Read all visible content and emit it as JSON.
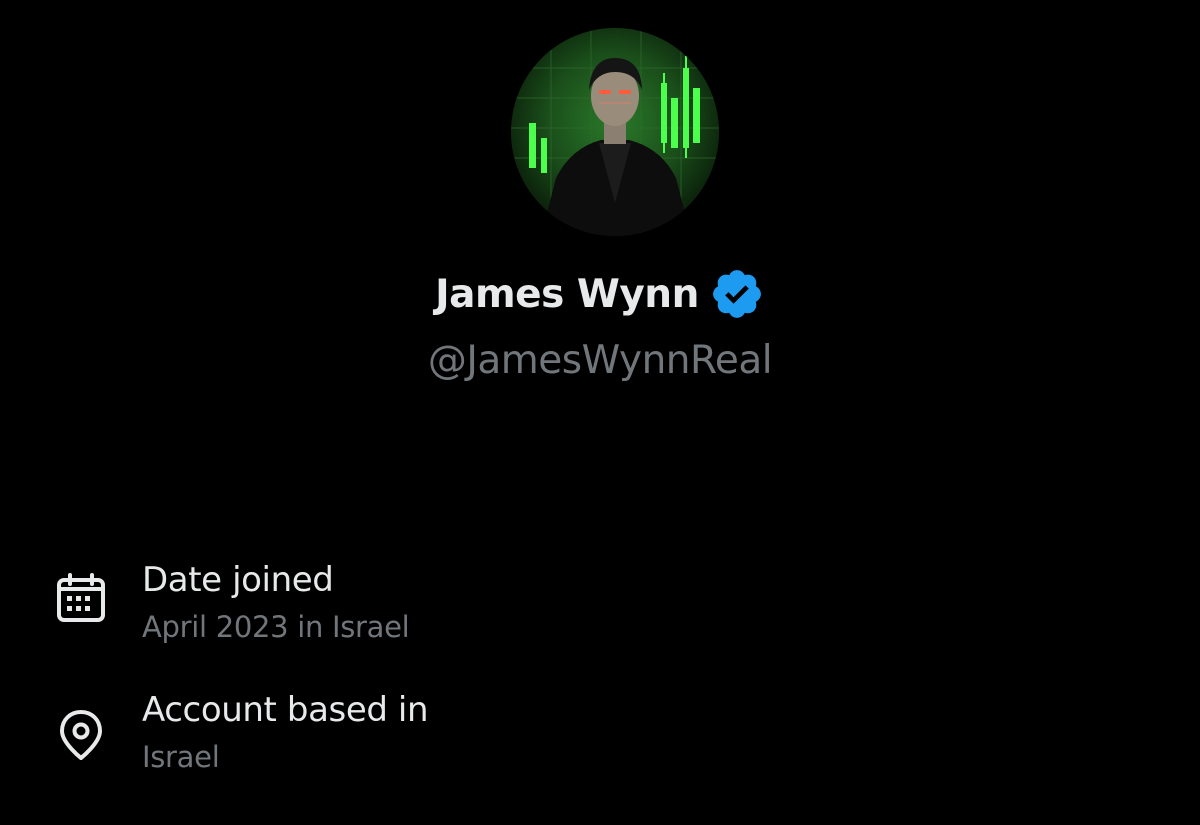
{
  "profile": {
    "display_name": "James Wynn",
    "handle": "@JamesWynnReal",
    "verified": true,
    "avatar_icon": "avatar-image"
  },
  "about": {
    "items": [
      {
        "icon": "calendar-icon",
        "title": "Date joined",
        "value": "April 2023 in Israel"
      },
      {
        "icon": "location-pin-icon",
        "title": "Account based in",
        "value": "Israel"
      }
    ]
  },
  "colors": {
    "background": "#000000",
    "primary_text": "#e7e9ea",
    "secondary_text": "#71767b",
    "verified_badge": "#1d9bf0",
    "avatar_accent": "#3ddc3d"
  }
}
